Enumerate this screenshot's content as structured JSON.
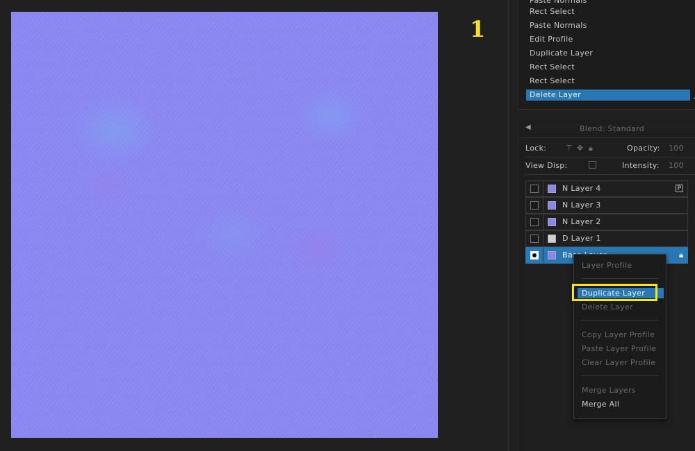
{
  "step_number": "1",
  "history": {
    "items": [
      {
        "label": "Paste Normals",
        "selected": false
      },
      {
        "label": "Rect Select",
        "selected": false
      },
      {
        "label": "Paste Normals",
        "selected": false
      },
      {
        "label": "Edit Profile",
        "selected": false
      },
      {
        "label": "Duplicate Layer",
        "selected": false
      },
      {
        "label": "Rect Select",
        "selected": false
      },
      {
        "label": "Rect Select",
        "selected": false
      },
      {
        "label": "Delete Layer",
        "selected": true
      }
    ]
  },
  "layers_panel": {
    "blend_label": "Blend: Standard",
    "lock_label": "Lock:",
    "opacity_label": "Opacity:",
    "opacity_value": "100",
    "view_disp_label": "View Disp:",
    "intensity_label": "Intensity:",
    "intensity_value": "100",
    "layers": [
      {
        "name": "N Layer 4",
        "swatch": "#8b86f5",
        "visible": false,
        "selected": false,
        "icon": "profile-icon"
      },
      {
        "name": "N Layer 3",
        "swatch": "#8b86f5",
        "visible": false,
        "selected": false
      },
      {
        "name": "N Layer 2",
        "swatch": "#8b86f5",
        "visible": false,
        "selected": false
      },
      {
        "name": "D Layer 1",
        "swatch": "#d0d0d0",
        "visible": false,
        "selected": false
      },
      {
        "name": "Base Layer",
        "swatch": "#8b86f5",
        "visible": true,
        "selected": true,
        "icon": "lock-icon"
      }
    ]
  },
  "context_menu": {
    "items": {
      "layer_profile": "Layer Profile",
      "duplicate_layer": "Duplicate Layer",
      "delete_layer": "Delete Layer",
      "copy_layer_profile": "Copy Layer Profile",
      "paste_layer_profile": "Paste Layer Profile",
      "clear_layer_profile": "Clear Layer Profile",
      "merge_layers": "Merge Layers",
      "merge_all": "Merge All"
    }
  },
  "colors": {
    "accent": "#2a78b3",
    "highlight": "#ffe21f",
    "canvas": "#8a87f2"
  }
}
